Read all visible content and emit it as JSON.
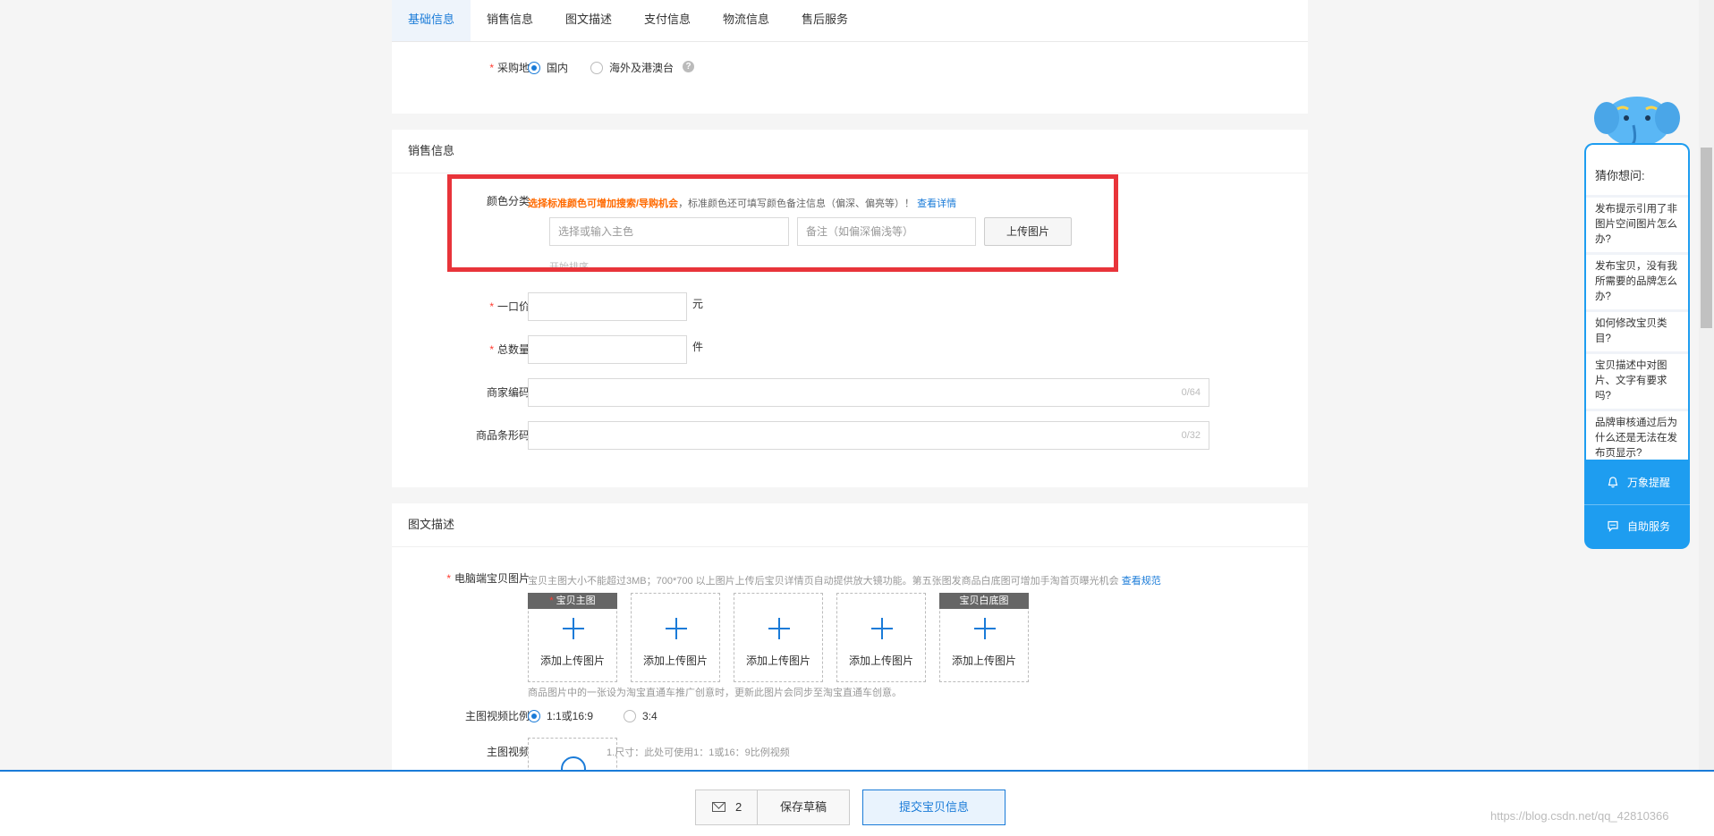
{
  "tabs": [
    "基础信息",
    "销售信息",
    "图文描述",
    "支付信息",
    "物流信息",
    "售后服务"
  ],
  "purchase": {
    "label": "采购地",
    "options": [
      "国内",
      "海外及港澳台"
    ],
    "selected": "国内",
    "help_icon": "?"
  },
  "sales": {
    "title": "销售信息",
    "color": {
      "label": "颜色分类",
      "hint_strong": "选择标准颜色可增加搜索/导购机会",
      "hint_text": "，标准颜色还可填写颜色备注信息（偏深、偏亮等）！",
      "hint_link": "查看详情",
      "main_placeholder": "选择或输入主色",
      "note_placeholder": "备注（如偏深偏浅等）",
      "upload_button": "上传图片",
      "clipped_text": "开始排序"
    },
    "price": {
      "label": "一口价",
      "unit": "元"
    },
    "quantity": {
      "label": "总数量",
      "unit": "件"
    },
    "merchant_code": {
      "label": "商家编码",
      "counter": "0/64"
    },
    "barcode": {
      "label": "商品条形码",
      "counter": "0/32"
    }
  },
  "desc": {
    "title": "图文描述",
    "pc_images": {
      "label": "电脑端宝贝图片",
      "hint": "宝贝主图大小不能超过3MB；700*700 以上图片上传后宝贝详情页自动提供放大镜功能。第五张图发商品白底图可增加手淘首页曝光机会",
      "hint_link": "查看规范",
      "tile_text": "添加上传图片",
      "main_tag": "宝贝主图",
      "white_tag": "宝贝白底图",
      "note": "商品图片中的一张设为淘宝直通车推广创意时，更新此图片会同步至淘宝直通车创意。"
    },
    "video_ratio": {
      "label": "主图视频比例",
      "options": [
        "1:1或16:9",
        "3:4"
      ],
      "selected": "1:1或16:9"
    },
    "video": {
      "label": "主图视频",
      "hint": "1.尺寸：此处可使用1：1或16：9比例视频"
    }
  },
  "bottom": {
    "mail_count": "2",
    "draft": "保存草稿",
    "submit": "提交宝贝信息"
  },
  "help": {
    "title": "猜你想问:",
    "questions": [
      "发布提示引用了非图片空间图片怎么办?",
      "发布宝贝，没有我所需要的品牌怎么办?",
      "如何修改宝贝类目?",
      "宝贝描述中对图片、文字有要求吗?",
      "品牌审核通过后为什么还是无法在发布页显示?"
    ],
    "reminder": "万象提醒",
    "service": "自助服务"
  },
  "watermark": "https://blog.csdn.net/qq_42810366",
  "colors": {
    "accent": "#1a7bd8",
    "highlight": "#e8343a",
    "required": "#ff3b30",
    "hint_orange": "#ff6a00",
    "widget": "#1e9df0"
  }
}
